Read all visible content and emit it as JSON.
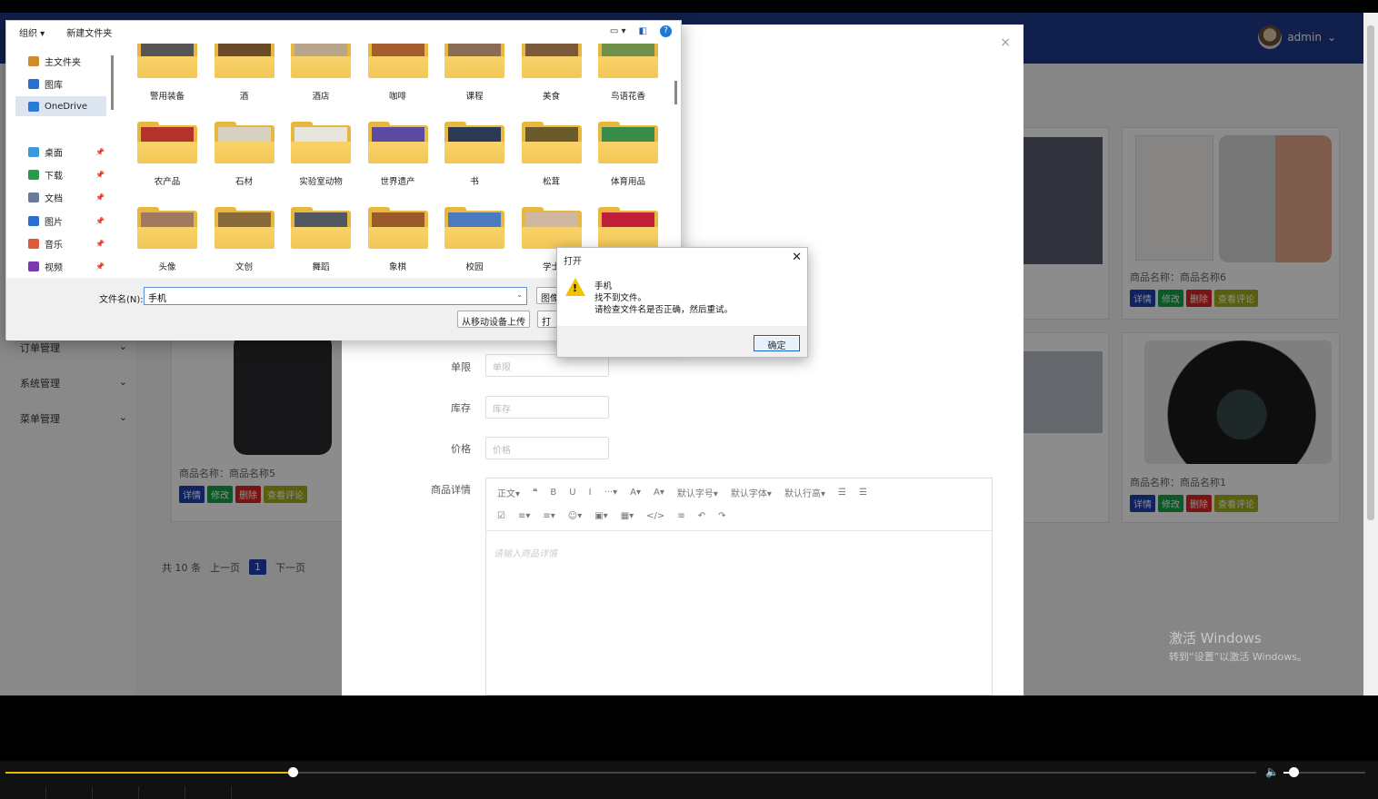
{
  "app": {
    "user": "admin",
    "sidebar": [
      {
        "label": "订单管理"
      },
      {
        "label": "系统管理"
      },
      {
        "label": "菜单管理"
      }
    ],
    "products": [
      {
        "name": "商品名称：商品名称5"
      },
      {
        "name": "商品名称：商品名称6"
      },
      {
        "name": "商品名称：商品名称1"
      }
    ],
    "actions": {
      "detail": "详情",
      "edit": "修改",
      "delete": "删除",
      "review": "查看评论"
    },
    "pager": {
      "total": "共 10 条",
      "prev": "上一页",
      "current": "1",
      "next": "下一页"
    }
  },
  "modal": {
    "close": "×",
    "fields": [
      {
        "label": "单限",
        "placeholder": "单限"
      },
      {
        "label": "库存",
        "placeholder": "库存"
      },
      {
        "label": "价格",
        "placeholder": "价格"
      }
    ],
    "detail_label": "商品详情",
    "editor": {
      "row1": [
        "正文▾",
        "❝",
        "B",
        "U",
        "I",
        "···▾",
        "A▾",
        "A▾",
        "默认字号▾",
        "默认字体▾",
        "默认行高▾",
        "☰",
        "☰"
      ],
      "row2": [
        "☑",
        "≡▾",
        "≡▾",
        "☺▾",
        "▣▾",
        "▦▾",
        "</>",
        "≡",
        "↶",
        "↷"
      ],
      "placeholder": "请输入商品详情"
    }
  },
  "file_dialog": {
    "toolbar": {
      "organize": "组织 ▾",
      "new_folder": "新建文件夹"
    },
    "nav": [
      {
        "label": "主文件夹",
        "icon": "home-icon",
        "pinned": false
      },
      {
        "label": "图库",
        "icon": "gallery-icon",
        "pinned": false
      },
      {
        "label": "OneDrive",
        "icon": "cloud-icon",
        "pinned": false,
        "selected": true
      },
      {
        "label": "桌面",
        "icon": "desktop-icon",
        "pinned": true
      },
      {
        "label": "下载",
        "icon": "download-icon",
        "pinned": true
      },
      {
        "label": "文档",
        "icon": "document-icon",
        "pinned": true
      },
      {
        "label": "图片",
        "icon": "pictures-icon",
        "pinned": true
      },
      {
        "label": "音乐",
        "icon": "music-icon",
        "pinned": true
      },
      {
        "label": "视频",
        "icon": "video-icon",
        "pinned": true
      }
    ],
    "folders": [
      {
        "label": "警用装备",
        "color": "#555"
      },
      {
        "label": "酒",
        "color": "#6b4a2a"
      },
      {
        "label": "酒店",
        "color": "#b8a58c"
      },
      {
        "label": "咖啡",
        "color": "#a65d2e"
      },
      {
        "label": "课程",
        "color": "#8a6b55"
      },
      {
        "label": "美食",
        "color": "#7a5a3a"
      },
      {
        "label": "鸟语花香",
        "color": "#6f8f4a"
      },
      {
        "label": "农产品",
        "color": "#b3332a"
      },
      {
        "label": "石材",
        "color": "#d8d0c0"
      },
      {
        "label": "实验室动物",
        "color": "#e8e4de"
      },
      {
        "label": "世界遗产",
        "color": "#5a4aa0"
      },
      {
        "label": "书",
        "color": "#2a3a55"
      },
      {
        "label": "松茸",
        "color": "#6a5a2a"
      },
      {
        "label": "体育用品",
        "color": "#3a8a4a"
      },
      {
        "label": "头像",
        "color": "#a07a60"
      },
      {
        "label": "文创",
        "color": "#8a6a3a"
      },
      {
        "label": "舞蹈",
        "color": "#505860"
      },
      {
        "label": "象棋",
        "color": "#9a5a2a"
      },
      {
        "label": "校园",
        "color": "#4a7ac0"
      },
      {
        "label": "学士",
        "color": "#d0b8a0"
      },
      {
        "label": "",
        "color": "#c0203a"
      }
    ],
    "filename_label": "文件名(N):",
    "filename_value": "手机",
    "filetype": "图像",
    "upload_button": "从移动设备上传",
    "open_button": "打"
  },
  "message_box": {
    "title": "打开",
    "close": "✕",
    "line1": "手机",
    "line2": "找不到文件。",
    "line3": "请检查文件名是否正确，然后重试。",
    "ok": "确定"
  },
  "watermark": {
    "line1": "激活 Windows",
    "line2": "转到“设置”以激活 Windows。"
  },
  "player": {
    "progress": 0.23,
    "volume": 0.12
  }
}
